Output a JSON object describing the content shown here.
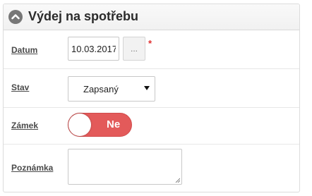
{
  "panel": {
    "title": "Výdej na spotřebu",
    "collapse_icon": "chevron-up-icon"
  },
  "fields": {
    "datum": {
      "label": "Datum",
      "value": "10.03.2017",
      "picker_label": "...",
      "required_mark": "*"
    },
    "stav": {
      "label": "Stav",
      "selected": "Zapsaný"
    },
    "zamek": {
      "label": "Zámek",
      "toggle_text": "Ne",
      "toggle_on": false,
      "toggle_color": "#e35a5a"
    },
    "poznamka": {
      "label": "Poznámka",
      "value": ""
    }
  }
}
